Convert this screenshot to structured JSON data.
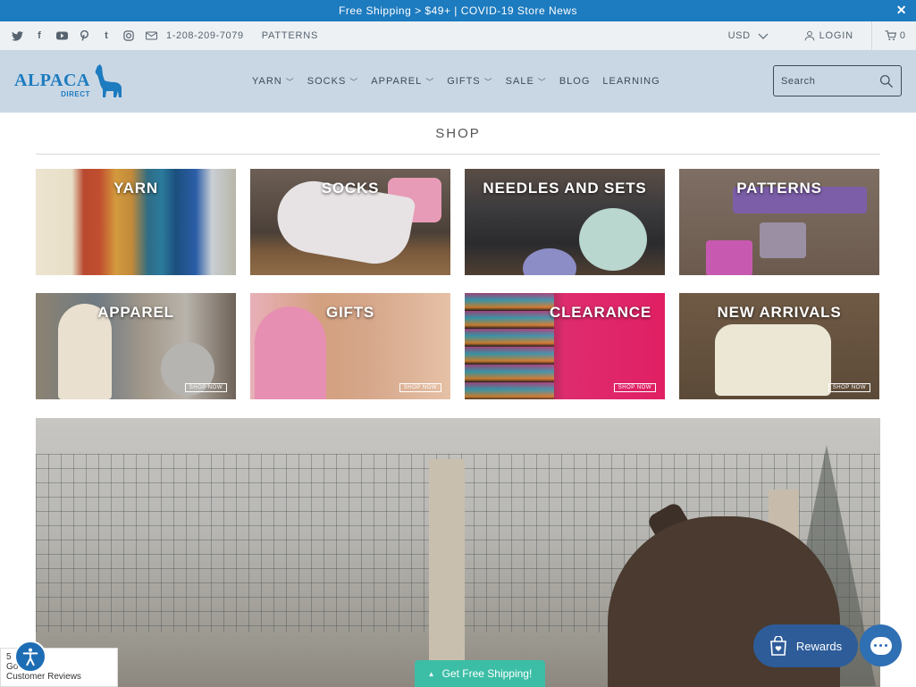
{
  "announcement": {
    "text": "Free Shipping > $49+ | COVID-19 Store News",
    "close": "✕"
  },
  "topbar": {
    "social": [
      "twitter-icon",
      "facebook-icon",
      "youtube-icon",
      "pinterest-icon",
      "tumblr-icon",
      "instagram-icon",
      "mail-icon"
    ],
    "phone": "1-208-209-7079",
    "patterns": "PATTERNS",
    "currency": "USD",
    "login": "LOGIN",
    "cart_count": "0"
  },
  "header": {
    "logo_word": "ALPACA",
    "logo_sub": "DIRECT",
    "nav": [
      {
        "label": "YARN",
        "dropdown": true
      },
      {
        "label": "SOCKS",
        "dropdown": true
      },
      {
        "label": "APPAREL",
        "dropdown": true
      },
      {
        "label": "GIFTS",
        "dropdown": true
      },
      {
        "label": "SALE",
        "dropdown": true
      },
      {
        "label": "BLOG",
        "dropdown": false
      },
      {
        "label": "LEARNING",
        "dropdown": false
      }
    ],
    "search_placeholder": "Search"
  },
  "shop": {
    "title": "SHOP",
    "tiles": [
      {
        "label": "YARN",
        "shop_now": ""
      },
      {
        "label": "SOCKS",
        "shop_now": ""
      },
      {
        "label": "NEEDLES AND SETS",
        "shop_now": ""
      },
      {
        "label": "PATTERNS",
        "shop_now": ""
      },
      {
        "label": "APPAREL",
        "shop_now": "SHOP NOW"
      },
      {
        "label": "GIFTS",
        "shop_now": "SHOP NOW"
      },
      {
        "label": "CLEARANCE",
        "shop_now": "SHOP NOW"
      },
      {
        "label": "NEW ARRIVALS",
        "shop_now": "SHOP NOW"
      }
    ]
  },
  "widgets": {
    "reviews_score": "5",
    "reviews_stars": "★★★",
    "reviews_brand": "Go",
    "reviews_label": "Customer Reviews",
    "shipping_tab": "Get Free Shipping!",
    "rewards": "Rewards"
  }
}
